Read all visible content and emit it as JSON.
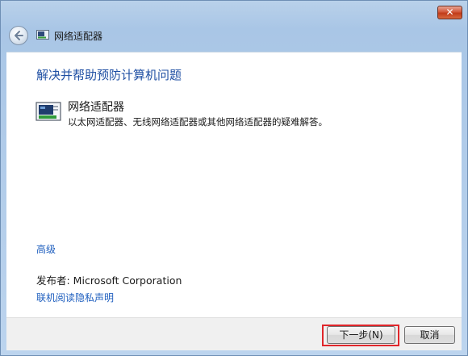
{
  "window": {
    "title": "网络适配器",
    "close_label": "✕"
  },
  "content": {
    "heading": "解决并帮助预防计算机问题",
    "item": {
      "title": "网络适配器",
      "description": "以太网适配器、无线网络适配器或其他网络适配器的疑难解答。",
      "icon": "network-adapter-icon"
    },
    "advanced_link": "高级",
    "publisher": "发布者: Microsoft Corporation",
    "privacy_link": "联机阅读隐私声明"
  },
  "footer": {
    "next_label": "下一步(N)",
    "cancel_label": "取消"
  },
  "colors": {
    "heading": "#1f4fa3",
    "link": "#1f5fbf",
    "highlight": "#e0262b"
  }
}
